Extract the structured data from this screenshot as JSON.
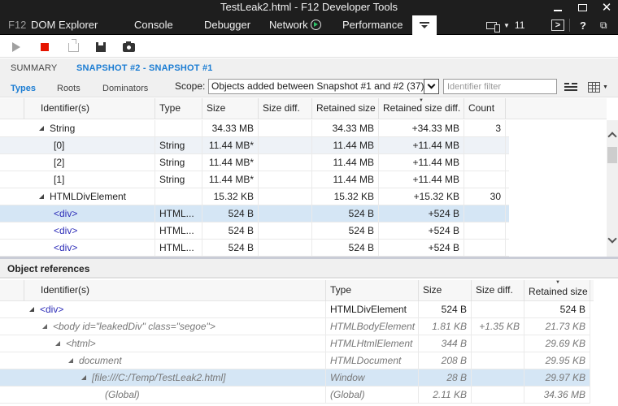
{
  "window": {
    "title": "TestLeak2.html - F12 Developer Tools",
    "minimize_icon": "minimize-icon",
    "maximize_icon": "maximize-icon",
    "close_icon": "close-icon"
  },
  "tabs": {
    "f12": "F12",
    "items": [
      "DOM Explorer",
      "Console",
      "Debugger",
      "Network",
      "Performance"
    ],
    "network_icon": "play-circle-icon",
    "memory_icon": "memory-icon",
    "emulation_count": "11",
    "help": "?"
  },
  "toolbar": {
    "buttons": [
      "start-profiling",
      "stop-profiling",
      "import",
      "export",
      "take-snapshot"
    ]
  },
  "summary": {
    "crumb_summary": "SUMMARY",
    "crumb_snapshot": "SNAPSHOT #2 - SNAPSHOT #1",
    "view_tabs": [
      "Types",
      "Roots",
      "Dominators"
    ],
    "active_view": "Types",
    "scope_label": "Scope:",
    "scope_value": "Objects added between Snapshot #1 and #2 (37)",
    "filter_placeholder": "Identifier filter"
  },
  "types_table": {
    "columns": [
      "Identifier(s)",
      "Type",
      "Size",
      "Size diff.",
      "Retained size",
      "Retained size diff.",
      "Count"
    ],
    "sorted_column": "Retained size diff.",
    "rows": [
      {
        "id": "String",
        "type": "",
        "size": "34.33 MB",
        "size_diff": "",
        "retained": "34.33 MB",
        "retained_diff": "+34.33 MB",
        "count": "3",
        "level": 0,
        "expanded": true
      },
      {
        "id": "[0]",
        "type": "String",
        "size": "11.44 MB*",
        "size_diff": "",
        "retained": "11.44 MB",
        "retained_diff": "+11.44 MB",
        "count": "",
        "level": 1
      },
      {
        "id": "[2]",
        "type": "String",
        "size": "11.44 MB*",
        "size_diff": "",
        "retained": "11.44 MB",
        "retained_diff": "+11.44 MB",
        "count": "",
        "level": 1
      },
      {
        "id": "[1]",
        "type": "String",
        "size": "11.44 MB*",
        "size_diff": "",
        "retained": "11.44 MB",
        "retained_diff": "+11.44 MB",
        "count": "",
        "level": 1
      },
      {
        "id": "HTMLDivElement",
        "type": "",
        "size": "15.32 KB",
        "size_diff": "",
        "retained": "15.32 KB",
        "retained_diff": "+15.32 KB",
        "count": "30",
        "level": 0,
        "expanded": true
      },
      {
        "id": "<div>",
        "type": "HTML...",
        "size": "524 B",
        "size_diff": "",
        "retained": "524 B",
        "retained_diff": "+524 B",
        "count": "",
        "level": 1,
        "selected": true
      },
      {
        "id": "<div>",
        "type": "HTML...",
        "size": "524 B",
        "size_diff": "",
        "retained": "524 B",
        "retained_diff": "+524 B",
        "count": "",
        "level": 1
      },
      {
        "id": "<div>",
        "type": "HTML...",
        "size": "524 B",
        "size_diff": "",
        "retained": "524 B",
        "retained_diff": "+524 B",
        "count": "",
        "level": 1
      }
    ]
  },
  "object_references": {
    "title": "Object references",
    "columns": [
      "Identifier(s)",
      "Type",
      "Size",
      "Size diff.",
      "Retained size"
    ],
    "sorted_column": "Retained size",
    "rows": [
      {
        "id": "<div>",
        "type": "HTMLDivElement",
        "size": "524 B",
        "size_diff": "",
        "retained": "524 B",
        "level": 0,
        "italic": false
      },
      {
        "id": "<body id=\"leakedDiv\" class=\"segoe\">",
        "type": "HTMLBodyElement",
        "size": "1.81 KB",
        "size_diff": "+1.35 KB",
        "retained": "21.73 KB",
        "level": 1,
        "italic": true
      },
      {
        "id": "<html>",
        "type": "HTMLHtmlElement",
        "size": "344 B",
        "size_diff": "",
        "retained": "29.69 KB",
        "level": 2,
        "italic": true
      },
      {
        "id": "document",
        "type": "HTMLDocument",
        "size": "208 B",
        "size_diff": "",
        "retained": "29.95 KB",
        "level": 3,
        "italic": true
      },
      {
        "id": "[file:///C:/Temp/TestLeak2.html]",
        "type": "Window",
        "size": "28 B",
        "size_diff": "",
        "retained": "29.97 KB",
        "level": 4,
        "italic": true,
        "selected": true
      },
      {
        "id": "(Global)",
        "type": "(Global)",
        "size": "2.11 KB",
        "size_diff": "",
        "retained": "34.36 MB",
        "level": 5,
        "italic": true,
        "leaf": true
      }
    ]
  },
  "colors": {
    "accent": "#1c7dd3",
    "selection": "#d5e6f5",
    "stop_red": "#e51400",
    "network_green": "#2ec26a",
    "tag_blue": "#2d2db8"
  }
}
